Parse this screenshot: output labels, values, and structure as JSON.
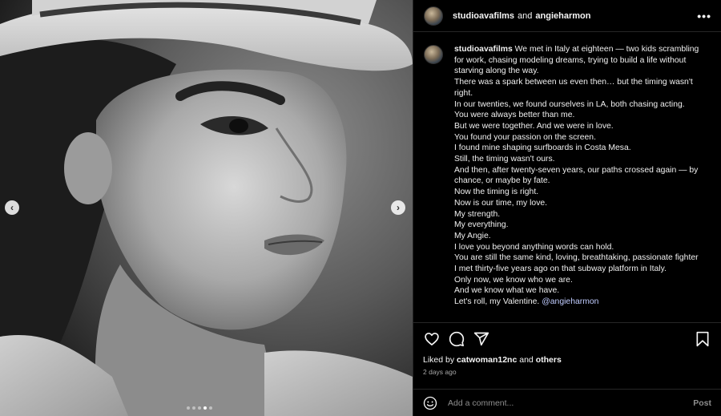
{
  "colors": {
    "background": "#000000",
    "text": "#f5f5f5",
    "muted": "#a8a8a8",
    "mention": "#c0ccff",
    "divider": "#262626"
  },
  "media": {
    "prev_arrow": "‹",
    "next_arrow": "›",
    "slide_count": 5,
    "active_slide": 4
  },
  "header": {
    "author": "studioavafilms",
    "conjunction": "and",
    "collaborator": "angieharmon",
    "more_icon": "more-icon",
    "more_glyph": "•••"
  },
  "caption": {
    "author": "studioavafilms",
    "first_line_text": "We met in Italy at eighteen — two kids scrambling for work, chasing modeling dreams, trying to build a life without starving along the way.",
    "lines": [
      "There was a spark between us even then… but the timing wasn't right.",
      "In our twenties, we found ourselves in LA, both chasing acting.",
      "You were always better than me.",
      "But we were together. And we were in love.",
      "You found your passion on the screen.",
      "I found mine shaping surfboards in Costa Mesa.",
      "Still, the timing wasn't ours.",
      "And then, after twenty-seven years, our paths crossed again — by chance, or maybe by fate.",
      "Now the timing is right.",
      "Now is our time, my love.",
      "My strength.",
      "My everything.",
      "My Angie.",
      "I love you beyond anything words can hold.",
      "You are still the same kind, loving, breathtaking, passionate fighter I met thirty-five years ago on that subway platform in Italy.",
      "Only now, we know who we are.",
      "And we know what we have."
    ],
    "last_line_text": "Let's roll, my Valentine.",
    "mention": "@angieharmon"
  },
  "actions": {
    "like_icon": "heart-icon",
    "comment_icon": "comment-icon",
    "share_icon": "share-icon",
    "save_icon": "bookmark-icon"
  },
  "likes": {
    "prefix": "Liked by",
    "user": "catwoman12nc",
    "conjunction": "and",
    "others": "others"
  },
  "timestamp": "2 days ago",
  "comment": {
    "emoji_icon": "emoji-icon",
    "placeholder": "Add a comment...",
    "post_label": "Post"
  }
}
